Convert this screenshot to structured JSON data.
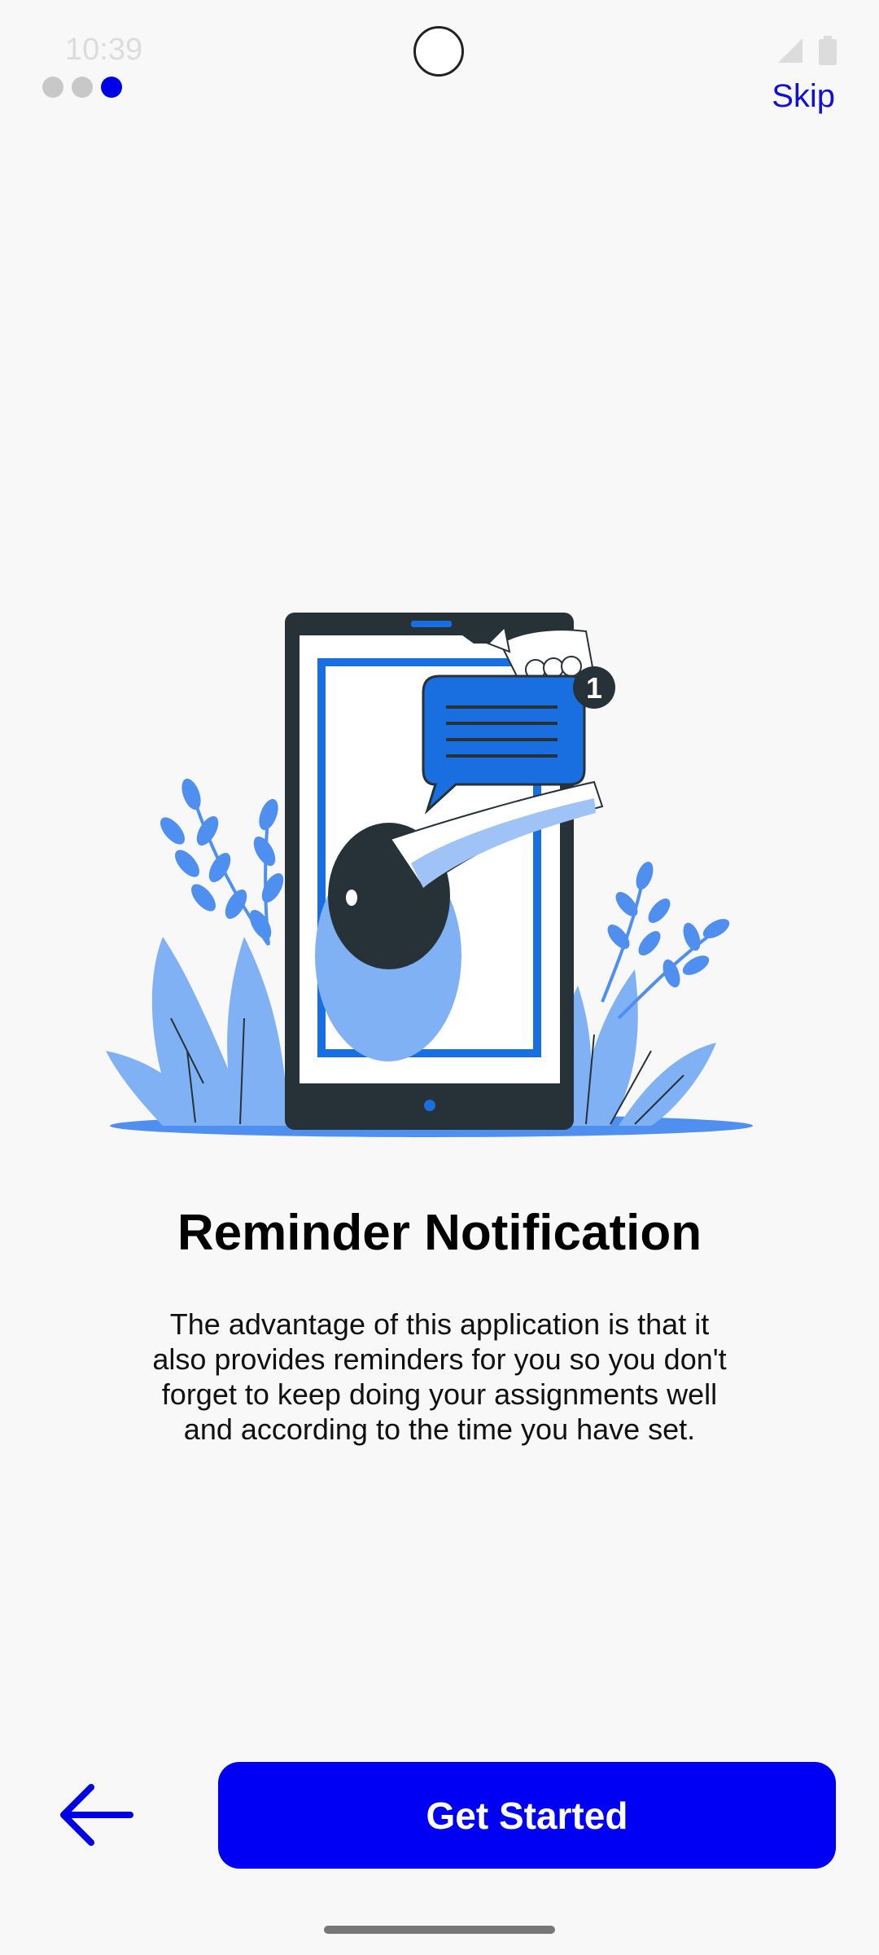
{
  "status_bar": {
    "time": "10:39",
    "icons": [
      "shield-icon",
      "sim-card-icon",
      "signal-icon",
      "battery-icon"
    ]
  },
  "onboarding": {
    "page_count": 3,
    "active_page": 3,
    "skip_label": "Skip",
    "title": "Reminder Notification",
    "description": "The advantage of this application is that it also provides reminders for you so you don't forget to keep doing your assignments well and according to the time you have set.",
    "notification_count": "1"
  },
  "footer": {
    "back_icon": "arrow-left-icon",
    "primary_label": "Get Started"
  },
  "colors": {
    "accent": "#0000f5",
    "illustration_blue": "#1a6fe0",
    "light_blue": "#7fb1f4",
    "dark": "#263238",
    "dot_inactive": "#c8c8c8",
    "background": "#f8f8f8"
  }
}
